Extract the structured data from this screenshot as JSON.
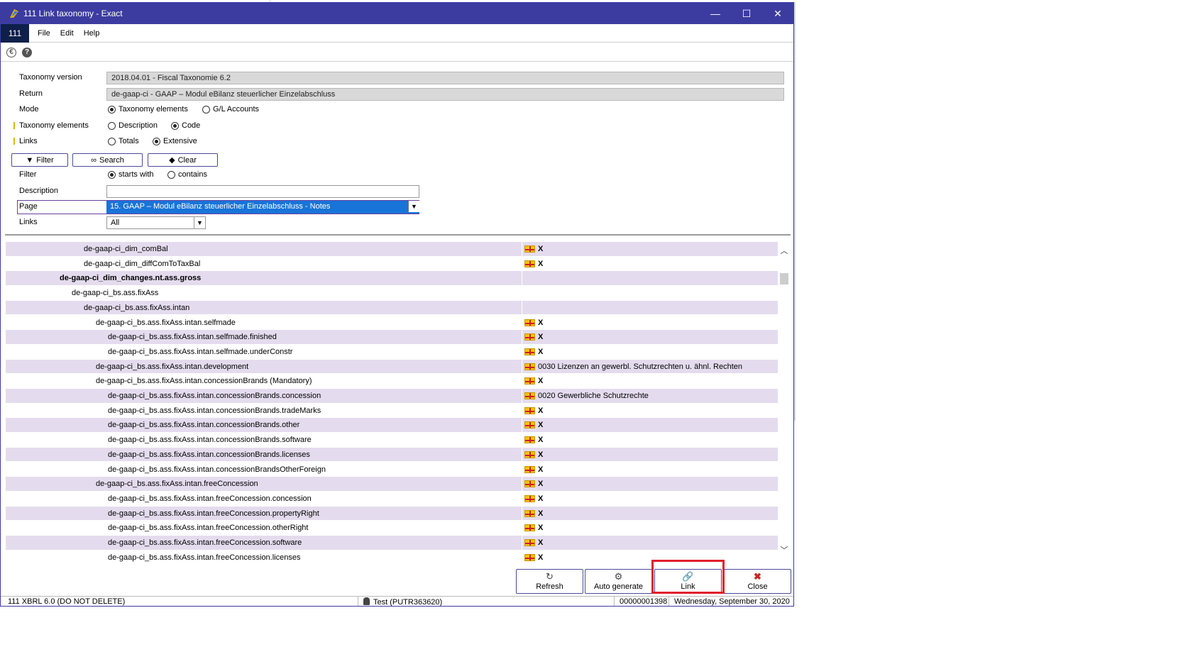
{
  "window": {
    "title": "111 Link taxonomy - Exact",
    "minimize": "—",
    "maximize": "☐",
    "close": "✕"
  },
  "menubar": {
    "company": "111",
    "items": [
      {
        "label": "File"
      },
      {
        "label": "Edit"
      },
      {
        "label": "Help"
      }
    ]
  },
  "form": {
    "taxonomy_version_label": "Taxonomy version",
    "taxonomy_version_value": "2018.04.01 - Fiscal Taxonomie 6.2",
    "return_label": "Return",
    "return_value": "de-gaap-ci - GAAP – Modul eBilanz steuerlicher Einzelabschluss",
    "mode_label": "Mode",
    "mode_options": [
      "Taxonomy elements",
      "G/L Accounts"
    ],
    "mode_selected": "Taxonomy elements",
    "taxonomy_elements_label": "Taxonomy elements",
    "taxonomy_elements_options": [
      "Description",
      "Code"
    ],
    "taxonomy_elements_selected": "Code",
    "links_label": "Links",
    "links_options": [
      "Totals",
      "Extensive"
    ],
    "links_selected": "Extensive",
    "filter_button": "Filter",
    "search_button": "Search",
    "clear_button": "Clear",
    "filter_label": "Filter",
    "filter_options": [
      "starts with",
      "contains"
    ],
    "filter_selected": "starts with",
    "description_label": "Description",
    "description_value": "",
    "page_label": "Page",
    "page_value": "15.  GAAP – Modul eBilanz steuerlicher Einzelabschluss - Notes",
    "links_filter_label": "Links",
    "links_filter_value": "All"
  },
  "grid": {
    "rows": [
      {
        "code": "de-gaap-ci_dim_comBal",
        "indent": 3,
        "bold": false,
        "link": "X",
        "has_flag": true
      },
      {
        "code": "de-gaap-ci_dim_diffComToTaxBal",
        "indent": 3,
        "bold": false,
        "link": "X",
        "has_flag": true
      },
      {
        "code": "de-gaap-ci_dim_changes.nt.ass.gross",
        "indent": 1,
        "bold": true,
        "link": "",
        "has_flag": false
      },
      {
        "code": "de-gaap-ci_bs.ass.fixAss",
        "indent": 2,
        "bold": false,
        "link": "",
        "has_flag": false
      },
      {
        "code": "de-gaap-ci_bs.ass.fixAss.intan",
        "indent": 3,
        "bold": false,
        "link": "",
        "has_flag": false
      },
      {
        "code": "de-gaap-ci_bs.ass.fixAss.intan.selfmade",
        "indent": 4,
        "bold": false,
        "link": "X",
        "has_flag": true
      },
      {
        "code": "de-gaap-ci_bs.ass.fixAss.intan.selfmade.finished",
        "indent": 5,
        "bold": false,
        "link": "X",
        "has_flag": true
      },
      {
        "code": "de-gaap-ci_bs.ass.fixAss.intan.selfmade.underConstr",
        "indent": 5,
        "bold": false,
        "link": "X",
        "has_flag": true
      },
      {
        "code": "de-gaap-ci_bs.ass.fixAss.intan.development",
        "indent": 4,
        "bold": false,
        "link": "0030 Lizenzen an gewerbl. Schutzrechten u. ähnl. Rechten",
        "has_flag": true
      },
      {
        "code": "de-gaap-ci_bs.ass.fixAss.intan.concessionBrands (Mandatory)",
        "indent": 4,
        "bold": false,
        "link": "X",
        "has_flag": true
      },
      {
        "code": "de-gaap-ci_bs.ass.fixAss.intan.concessionBrands.concession",
        "indent": 5,
        "bold": false,
        "link": "0020 Gewerbliche Schutzrechte",
        "has_flag": true
      },
      {
        "code": "de-gaap-ci_bs.ass.fixAss.intan.concessionBrands.tradeMarks",
        "indent": 5,
        "bold": false,
        "link": "X",
        "has_flag": true
      },
      {
        "code": "de-gaap-ci_bs.ass.fixAss.intan.concessionBrands.other",
        "indent": 5,
        "bold": false,
        "link": "X",
        "has_flag": true
      },
      {
        "code": "de-gaap-ci_bs.ass.fixAss.intan.concessionBrands.software",
        "indent": 5,
        "bold": false,
        "link": "X",
        "has_flag": true
      },
      {
        "code": "de-gaap-ci_bs.ass.fixAss.intan.concessionBrands.licenses",
        "indent": 5,
        "bold": false,
        "link": "X",
        "has_flag": true
      },
      {
        "code": "de-gaap-ci_bs.ass.fixAss.intan.concessionBrandsOtherForeign",
        "indent": 5,
        "bold": false,
        "link": "X",
        "has_flag": true
      },
      {
        "code": "de-gaap-ci_bs.ass.fixAss.intan.freeConcession",
        "indent": 4,
        "bold": false,
        "link": "X",
        "has_flag": true
      },
      {
        "code": "de-gaap-ci_bs.ass.fixAss.intan.freeConcession.concession",
        "indent": 5,
        "bold": false,
        "link": "X",
        "has_flag": true
      },
      {
        "code": "de-gaap-ci_bs.ass.fixAss.intan.freeConcession.propertyRight",
        "indent": 5,
        "bold": false,
        "link": "X",
        "has_flag": true
      },
      {
        "code": "de-gaap-ci_bs.ass.fixAss.intan.freeConcession.otherRight",
        "indent": 5,
        "bold": false,
        "link": "X",
        "has_flag": true
      },
      {
        "code": "de-gaap-ci_bs.ass.fixAss.intan.freeConcession.software",
        "indent": 5,
        "bold": false,
        "link": "X",
        "has_flag": true
      },
      {
        "code": "de-gaap-ci_bs.ass.fixAss.intan.freeConcession.licenses",
        "indent": 5,
        "bold": false,
        "link": "X",
        "has_flag": true
      }
    ]
  },
  "buttons": {
    "refresh": "Refresh",
    "auto_generate": "Auto generate",
    "link": "Link",
    "close": "Close"
  },
  "statusbar": {
    "company": "111 XBRL 6.0 (DO NOT DELETE)",
    "user": "Test (PUTR363620)",
    "number": "00000001398",
    "date": "Wednesday, September 30, 2020"
  },
  "colors": {
    "titlebar": "#3c3ca0",
    "row_alt": "#e4dcee",
    "highlight": "#e0202a",
    "select_blue": "#1874d8"
  }
}
